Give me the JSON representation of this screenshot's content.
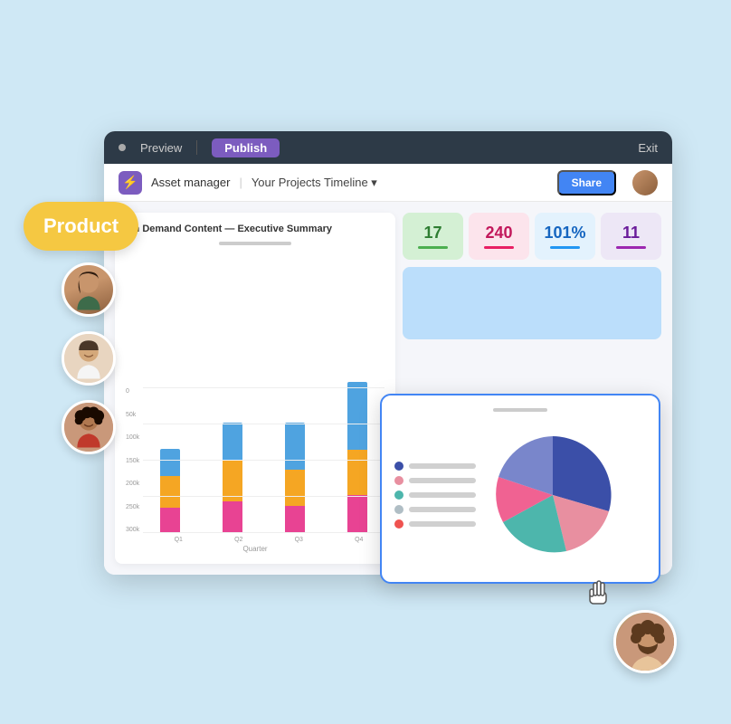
{
  "background_color": "#d6eef7",
  "product_badge": {
    "label": "Product"
  },
  "topbar": {
    "dot_color": "#aaaaaa",
    "preview_label": "Preview",
    "publish_label": "Publish",
    "exit_label": "Exit"
  },
  "subbar": {
    "logo_symbol": "⚡",
    "title": "Asset manager",
    "separator": "|",
    "nav": "Your Projects Timeline ▾",
    "share_label": "Share"
  },
  "chart": {
    "title": "On Demand Content — Executive Summary",
    "y_labels": [
      "300k",
      "250k",
      "200k",
      "150k",
      "100k",
      "50k",
      "0"
    ],
    "quarters": [
      "Q1",
      "Q2",
      "Q3",
      "Q4"
    ],
    "x_axis_label": "Quarter",
    "bars": [
      {
        "blue": 30,
        "orange": 35,
        "pink": 28
      },
      {
        "blue": 42,
        "orange": 45,
        "pink": 35
      },
      {
        "blue": 52,
        "orange": 40,
        "pink": 30
      },
      {
        "blue": 75,
        "orange": 50,
        "pink": 42
      }
    ]
  },
  "stats": [
    {
      "value": "17",
      "type": "green"
    },
    {
      "value": "240",
      "type": "pink-light"
    },
    {
      "value": "101%",
      "type": "blue-light"
    },
    {
      "value": "11",
      "type": "purple-light"
    }
  ],
  "pie_chart": {
    "legend": [
      {
        "color": "#3b4fa8",
        "label": ""
      },
      {
        "color": "#e8a0a8",
        "label": ""
      },
      {
        "color": "#4db6ac",
        "label": ""
      },
      {
        "color": "#b0bec5",
        "label": ""
      },
      {
        "color": "#ef5350",
        "label": ""
      }
    ],
    "segments": [
      {
        "color": "#3b4fa8",
        "percent": 32
      },
      {
        "color": "#e88fa0",
        "percent": 22
      },
      {
        "color": "#4db6ac",
        "percent": 20
      },
      {
        "color": "#f06292",
        "percent": 14
      },
      {
        "color": "#7986cb",
        "percent": 12
      }
    ]
  },
  "avatars": [
    {
      "id": "a1",
      "skin": "#c8956c"
    },
    {
      "id": "a2",
      "skin": "#d4a87a"
    },
    {
      "id": "a3",
      "skin": "#a0522d"
    }
  ],
  "cursor_symbol": "☞"
}
